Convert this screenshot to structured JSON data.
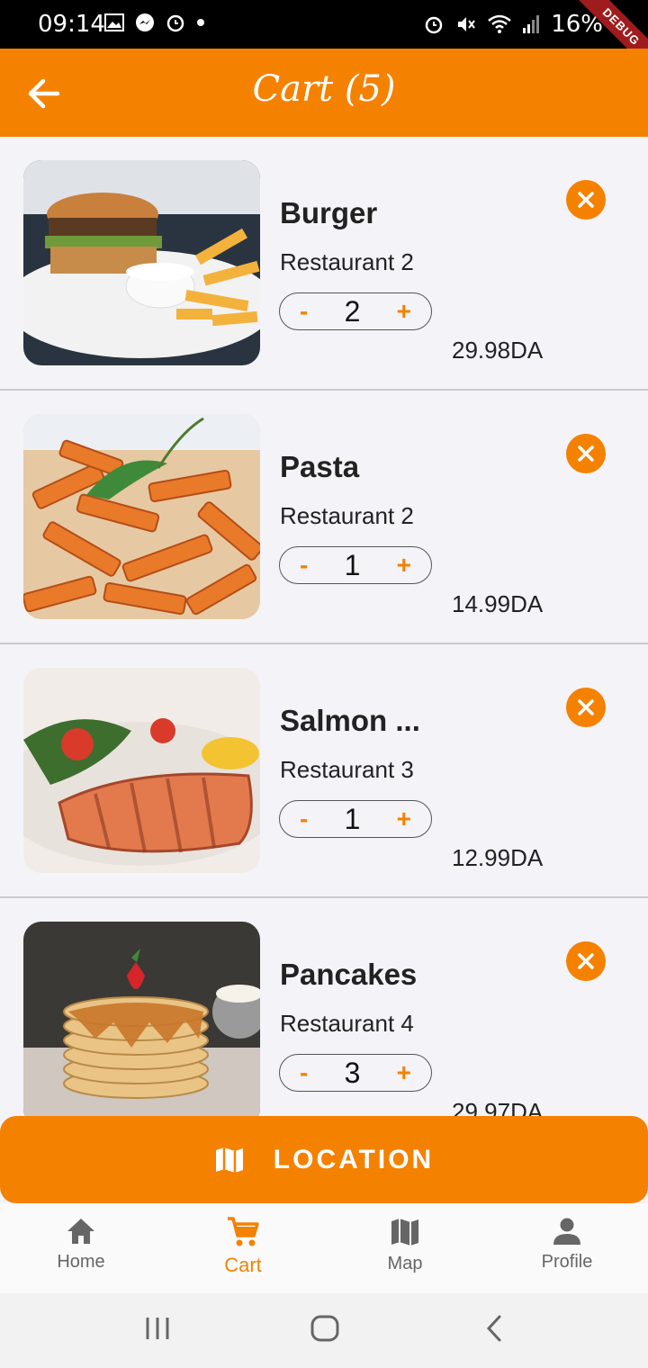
{
  "status_bar": {
    "time": "09:14",
    "battery": "16%",
    "debug_label": "DEBUG"
  },
  "app_bar": {
    "title": "Cart (5)"
  },
  "cart_items": [
    {
      "name": "Burger",
      "restaurant": "Restaurant 2",
      "quantity": "2",
      "price": "29.98DA",
      "image": "burger-with-fries"
    },
    {
      "name": "Pasta",
      "restaurant": "Restaurant 2",
      "quantity": "1",
      "price": "14.99DA",
      "image": "penne-pasta"
    },
    {
      "name": "Salmon ...",
      "restaurant": "Restaurant 3",
      "quantity": "1",
      "price": "12.99DA",
      "image": "grilled-salmon"
    },
    {
      "name": "Pancakes",
      "restaurant": "Restaurant 4",
      "quantity": "3",
      "price": "29.97DA",
      "image": "pancake-stack"
    }
  ],
  "stepper": {
    "minus": "-",
    "plus": "+"
  },
  "location_button": {
    "label": "LOCATION"
  },
  "bottom_nav": [
    {
      "label": "Home",
      "icon": "home-icon"
    },
    {
      "label": "Cart",
      "icon": "cart-icon",
      "active": true
    },
    {
      "label": "Map",
      "icon": "map-icon"
    },
    {
      "label": "Profile",
      "icon": "profile-icon"
    }
  ],
  "colors": {
    "accent": "#f58100",
    "background": "#f4f3f8"
  }
}
